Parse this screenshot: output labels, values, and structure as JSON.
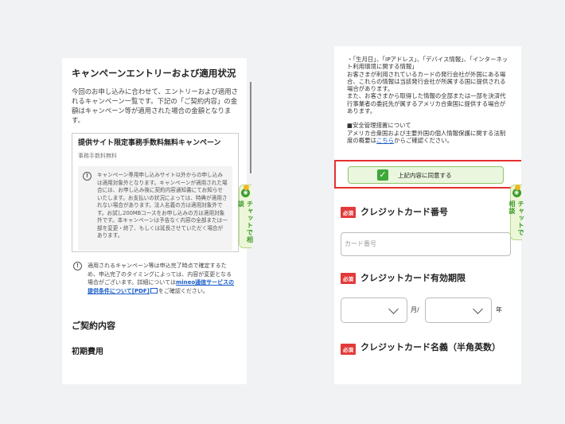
{
  "left": {
    "title": "キャンペーンエントリーおよび適用状況",
    "description": "今回のお申し込みに合わせて、エントリーおよび適用されるキャンペーン一覧です。下記の「ご契約内容」の金額はキャンペーン等が適用された場合の金額となります。",
    "campaign": {
      "title": "提供サイト限定事務手数料無料キャンペーン",
      "subtitle": "事務手数料無料",
      "notice": "キャンペーン専用申し込みサイト以外からの申し込みは適用対象外となります。キャンペーンが適用された場合には、お申し込み後に契約内容通知書にてお知らせいたします。お支払いの状況によっては、特典が適用されない場合があります。法人名義の方は適用対象外です。お試し200MBコースをお申し込みの方は適用対象外です。本キャンペーンは予告なく内容の全部または一部を変更・終了、もしくは延長させていただく場合があります。"
    },
    "info": {
      "text_before": "適用されるキャンペーン等は申込完了時点で確定するため、申込完了のタイミングによっては、内容が変更となる場合がございます。詳細については",
      "link": "mineo通信サービスの提供条件について[PDF]",
      "text_after": "をご確認ください。"
    },
    "contract_title": "ご契約内容",
    "initial_cost_title": "初期費用"
  },
  "chat": {
    "label": "チャットで相談",
    "icon_glyph": "◉"
  },
  "right": {
    "terms_lines": [
      "・「生月日」、「IPアドレス」、「デバイス情報」、「インターネット利用環境に関する情報」",
      "お客さまが利用されているカードの発行会社が外国にある場合、これらの情報は当該発行会社が所属する国に提供される場合があります。",
      "また、お客さまから取得した情報の全部または一部を決済代行事業者の委託先が属するアメリカ合衆国に提供する場合があります。"
    ],
    "security_title": "■安全管理措置について",
    "security_text": "アメリカ合衆国および主要外国の個人情報保護に関する法制度の概要は",
    "security_link": "こちら",
    "security_after": "からご確認ください。",
    "agree_label": "上記内容に同意する",
    "required_badge": "必須",
    "card_number_label": "クレジットカード番号",
    "card_number_placeholder": "カード番号",
    "expiry_label": "クレジットカード有効期限",
    "month_unit": "月/",
    "year_unit": "年",
    "card_name_label": "クレジットカード名義（半角英数）"
  },
  "colors": {
    "accent_green": "#3ea838",
    "required_red": "#e23a3a",
    "highlight_red": "#e5302f",
    "link_blue": "#1a5cc8"
  }
}
